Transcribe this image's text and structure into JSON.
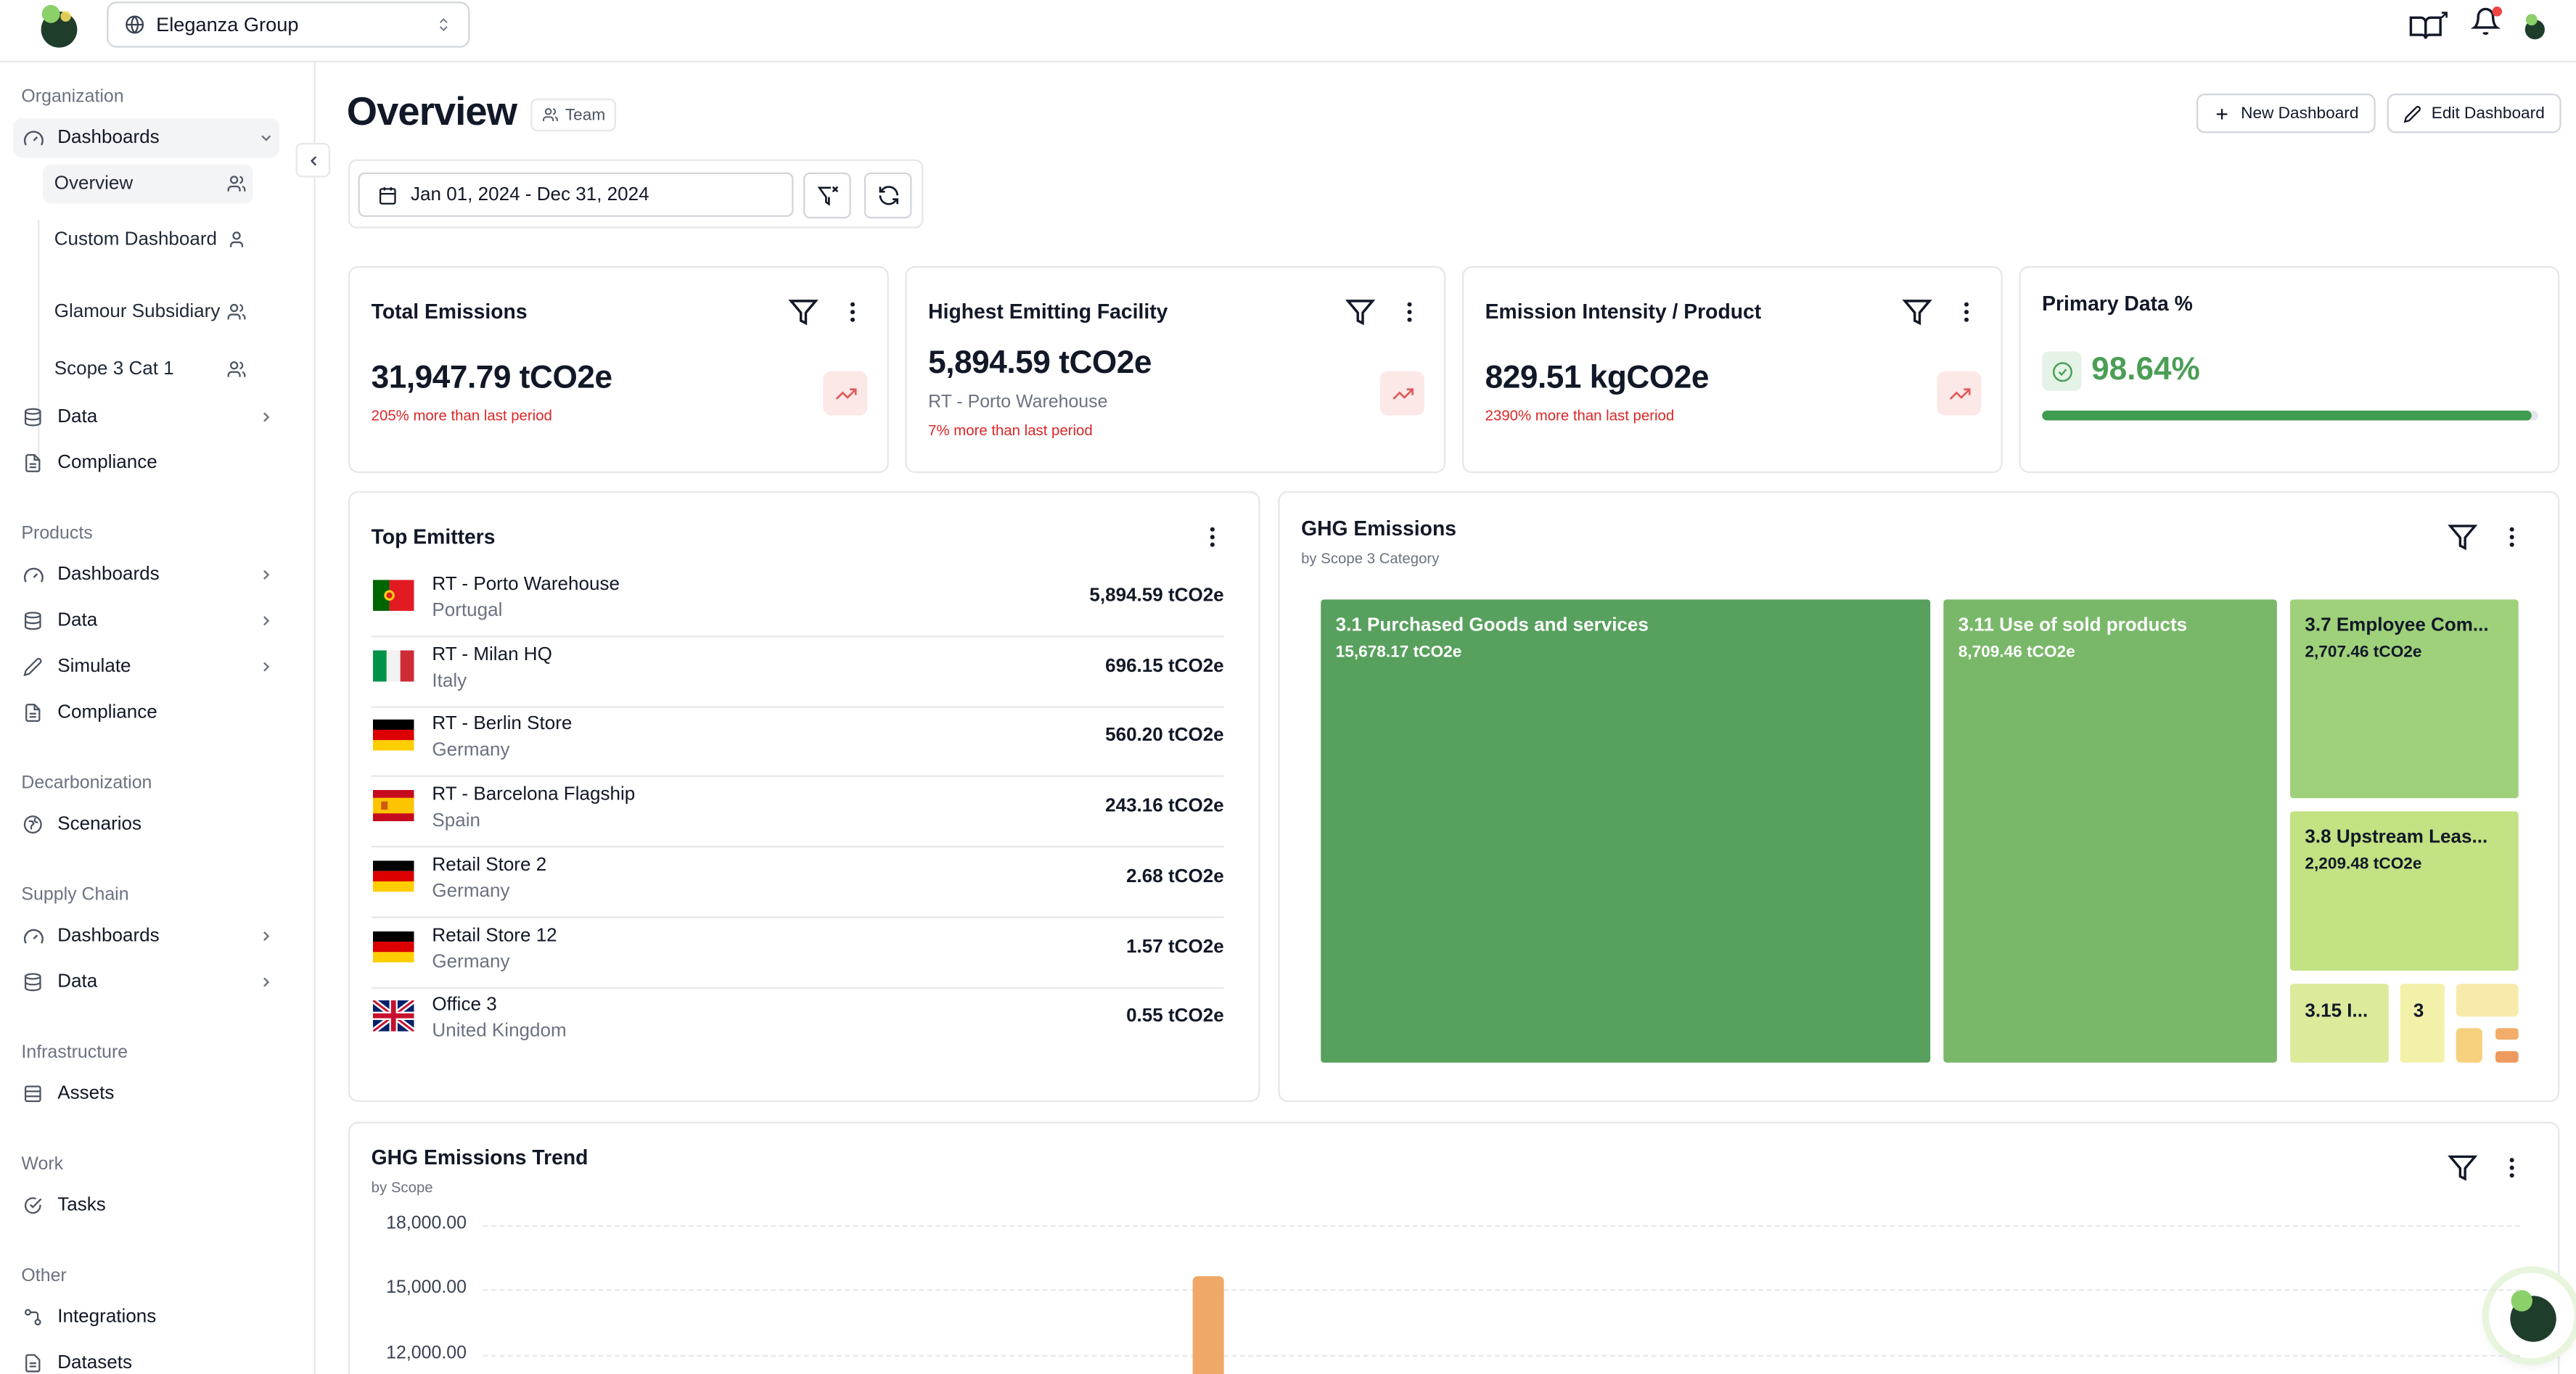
{
  "org_selector": {
    "value": "Eleganza Group"
  },
  "sidebar": {
    "organization": {
      "title": "Organization",
      "dashboards": "Dashboards",
      "sub_items": [
        "Overview",
        "Custom Dashboard",
        "Glamour Subsidiary",
        "Scope 3 Cat 1"
      ],
      "data": "Data",
      "compliance": "Compliance"
    },
    "products": {
      "title": "Products",
      "dashboards": "Dashboards",
      "data": "Data",
      "simulate": "Simulate",
      "compliance": "Compliance"
    },
    "decarbonization": {
      "title": "Decarbonization",
      "scenarios": "Scenarios"
    },
    "supply_chain": {
      "title": "Supply Chain",
      "dashboards": "Dashboards",
      "data": "Data"
    },
    "infrastructure": {
      "title": "Infrastructure",
      "assets": "Assets"
    },
    "work": {
      "title": "Work",
      "tasks": "Tasks"
    },
    "other": {
      "title": "Other",
      "integrations": "Integrations",
      "datasets": "Datasets"
    }
  },
  "header": {
    "title": "Overview",
    "badge": "Team",
    "new_dashboard": "New Dashboard",
    "edit_dashboard": "Edit Dashboard",
    "date_range": "Jan 01, 2024 - Dec 31, 2024"
  },
  "kpis": {
    "total": {
      "title": "Total Emissions",
      "value": "31,947.79 tCO2e",
      "change": "205% more than last period"
    },
    "facility": {
      "title": "Highest Emitting Facility",
      "value": "5,894.59 tCO2e",
      "location": "RT - Porto Warehouse",
      "change": "7% more than last period"
    },
    "intensity": {
      "title": "Emission Intensity / Product",
      "value": "829.51 kgCO2e",
      "change": "2390% more than last period"
    },
    "primary": {
      "title": "Primary Data %",
      "value": "98.64%",
      "fraction": 0.9864
    }
  },
  "top_emitters": {
    "title": "Top Emitters",
    "rows": [
      {
        "name": "RT - Porto Warehouse",
        "country": "Portugal",
        "value": "5,894.59 tCO2e",
        "flag": "portugal"
      },
      {
        "name": "RT - Milan HQ",
        "country": "Italy",
        "value": "696.15 tCO2e",
        "flag": "italy"
      },
      {
        "name": "RT - Berlin Store",
        "country": "Germany",
        "value": "560.20 tCO2e",
        "flag": "germany"
      },
      {
        "name": "RT - Barcelona Flagship",
        "country": "Spain",
        "value": "243.16 tCO2e",
        "flag": "spain"
      },
      {
        "name": "Retail Store 2",
        "country": "Germany",
        "value": "2.68 tCO2e",
        "flag": "germany"
      },
      {
        "name": "Retail Store 12",
        "country": "Germany",
        "value": "1.57 tCO2e",
        "flag": "germany"
      },
      {
        "name": "Office 3",
        "country": "United Kingdom",
        "value": "0.55 tCO2e",
        "flag": "uk"
      }
    ]
  },
  "ghg_treemap": {
    "title": "GHG Emissions",
    "subtitle": "by Scope 3 Category",
    "tiles": [
      {
        "label": "3.1 Purchased Goods and services",
        "value": "15,678.17 tCO2e",
        "color": "#57a05d"
      },
      {
        "label": "3.11 Use of sold products",
        "value": "8,709.46 tCO2e",
        "color": "#79b869"
      },
      {
        "label": "3.7 Employee Com...",
        "value": "2,707.46 tCO2e",
        "color": "#9fd17a"
      },
      {
        "label": "3.8 Upstream Leas...",
        "value": "2,209.48 tCO2e",
        "color": "#c2e283"
      },
      {
        "label": "3.15 I...",
        "color": "#dbeb9b"
      },
      {
        "label": "3",
        "color": "#f3f1a9"
      }
    ]
  },
  "trend": {
    "title": "GHG Emissions Trend",
    "subtitle": "by Scope",
    "y_ticks": [
      "18,000.00",
      "15,000.00",
      "12,000.00"
    ]
  },
  "chart_data": {
    "type": "bar",
    "title": "GHG Emissions Trend",
    "subtitle": "by Scope",
    "ylim": [
      12000,
      18000
    ],
    "y_ticks": [
      18000,
      15000,
      12000
    ],
    "series": [
      {
        "values": [
          15600
        ]
      }
    ],
    "color": "#f0a868",
    "grid": true
  }
}
